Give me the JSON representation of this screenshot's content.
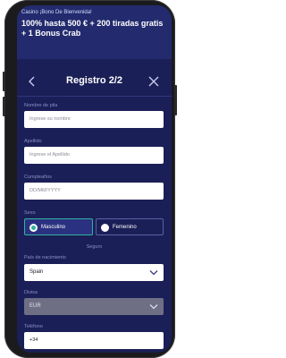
{
  "banner": {
    "small": "Casino ¡Bono De Bienvenida!",
    "big": "100% hasta 500 € + 200 tiradas gratis + 1 Bonus Crab"
  },
  "header": {
    "title": "Registro 2/2"
  },
  "form": {
    "nombre": {
      "label": "Nombre de pila",
      "placeholder": "Ingrese su nombre"
    },
    "apellido": {
      "label": "Apellido",
      "placeholder": "Ingrese el Apellido"
    },
    "cumpleanos": {
      "label": "Cumpleaños",
      "placeholder": "DD/MM/YYYY"
    },
    "sexo": {
      "label": "Sexo",
      "options": [
        "Masculino",
        "Femenino"
      ],
      "selected": "Masculino"
    },
    "seguro": "Seguro",
    "pais": {
      "label": "País de nacimiento",
      "value": "Spain"
    },
    "divisa": {
      "label": "Divisa",
      "value": "EUR"
    },
    "telefono": {
      "label": "Teléfono",
      "value": "+34"
    }
  },
  "colors": {
    "screen_bg": "#1b1f57",
    "banner_bg": "#232b6e",
    "accent_teal": "#2fb3a0",
    "muted_label": "#8a90c6"
  }
}
